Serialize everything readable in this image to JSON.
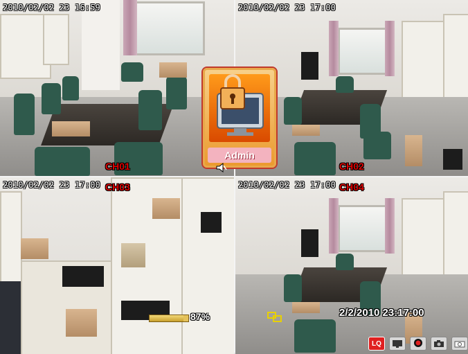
{
  "channels": [
    {
      "timestamp": "2010/02/02  23  16:59",
      "label": "CH01"
    },
    {
      "timestamp": "2010/02/02  23  17:00",
      "label": "CH02"
    },
    {
      "timestamp": "2010/02/02  23  17:00",
      "label": "CH03"
    },
    {
      "timestamp": "2010/02/02  23  17:00",
      "label": "CH04"
    }
  ],
  "login": {
    "label": "Admin",
    "icon": "lock-monitor-icon"
  },
  "progress": {
    "value": 0.87,
    "text": "87%"
  },
  "clock": "2/2/2010 23:17:00",
  "toolbar": {
    "items": [
      {
        "name": "lq-button",
        "label": "LQ",
        "icon": "lq-icon"
      },
      {
        "name": "display-button",
        "icon": "monitor-icon"
      },
      {
        "name": "record-button",
        "icon": "record-icon"
      },
      {
        "name": "snapshot-button",
        "icon": "camera-icon"
      },
      {
        "name": "camera-button",
        "icon": "camera-icon"
      }
    ]
  },
  "colors": {
    "channel_label": "#e00000",
    "login_panel": "#ec9a2e",
    "record": "#e02020"
  }
}
